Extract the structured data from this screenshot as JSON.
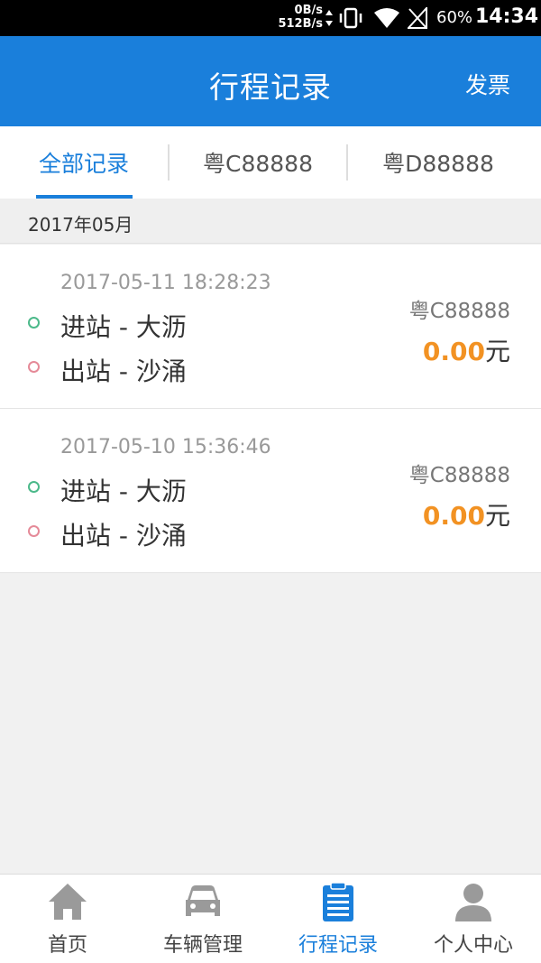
{
  "status_bar": {
    "net_up": "0B/s",
    "net_down": "512B/s",
    "battery": "60%",
    "time": "14:34"
  },
  "header": {
    "title": "行程记录",
    "action": "发票"
  },
  "tabs": [
    {
      "label": "全部记录",
      "active": true
    },
    {
      "label": "粤C88888",
      "active": false
    },
    {
      "label": "粤D88888",
      "active": false
    }
  ],
  "month": "2017年05月",
  "records": [
    {
      "time": "2017-05-11 18:28:23",
      "entry": "进站 - 大沥",
      "exit": "出站 - 沙涌",
      "plate": "粤C88888",
      "amount": "0.00",
      "unit": "元"
    },
    {
      "time": "2017-05-10 15:36:46",
      "entry": "进站 - 大沥",
      "exit": "出站 - 沙涌",
      "plate": "粤C88888",
      "amount": "0.00",
      "unit": "元"
    }
  ],
  "bottom_nav": [
    {
      "label": "首页",
      "icon": "home-icon"
    },
    {
      "label": "车辆管理",
      "icon": "car-icon"
    },
    {
      "label": "行程记录",
      "icon": "clipboard-icon",
      "active": true
    },
    {
      "label": "个人中心",
      "icon": "person-icon"
    }
  ],
  "colors": {
    "primary": "#1a7fdb",
    "amount": "#f29223",
    "entry_dot": "#4cb98a",
    "exit_dot": "#e58a98"
  }
}
